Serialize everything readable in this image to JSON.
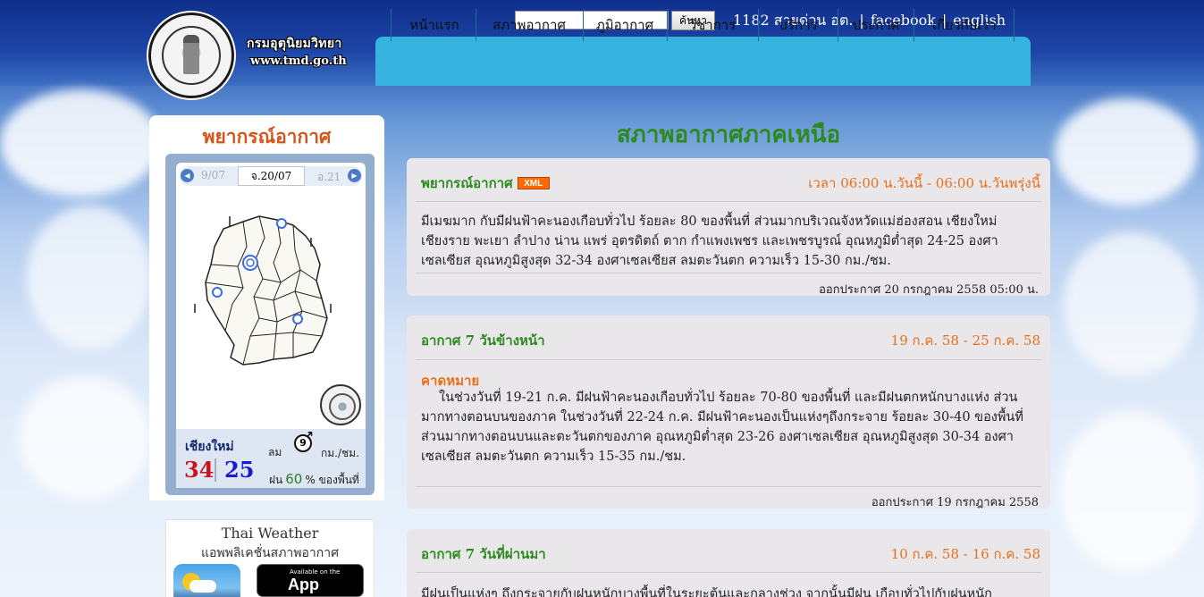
{
  "header": {
    "logo_text_th": "กรมอุตุนิยมวิทยา",
    "logo_url": "www.tmd.go.th",
    "search": {
      "value": "",
      "button_label": "ค้นหา"
    },
    "hotline": "1182 สายด่วน อต.",
    "facebook_label": "facebook",
    "english_label": "english"
  },
  "nav": {
    "items": [
      {
        "label": "หน้าแรก"
      },
      {
        "label": "สภาพอากาศ"
      },
      {
        "label": "ภูมิอากาศ"
      },
      {
        "label": "วิชาการ"
      },
      {
        "label": "บริการ"
      },
      {
        "label": "ประกาศ"
      },
      {
        "label": "เกี่ยวกับเรา"
      }
    ]
  },
  "sidebar": {
    "title": "พยากรณ์อากาศ",
    "dates": {
      "prev": "9/07",
      "current": "จ.20/07",
      "next": "อ.21"
    },
    "station": {
      "name": "เชียงใหม่",
      "temp_max": "34",
      "temp_min": "25",
      "wind_label": "ลม",
      "wind_speed": "9",
      "wind_unit": "กม./ชม.",
      "rain_label": "ฝน",
      "rain_value": "60",
      "rain_unit": "% ของพื้นที่"
    },
    "app": {
      "title": "Thai Weather",
      "subtitle": "แอพพลิเคชั่นสภาพอากาศ",
      "store_small": "Available on the",
      "store_big": "App Store"
    }
  },
  "main": {
    "title": "สภาพอากาศภาคเหนือ",
    "forecast": {
      "title": "พยากรณ์อากาศ",
      "xml_label": "XML",
      "period": "เวลา 06:00 น.วันนี้ - 06:00 น.วันพรุ่งนี้",
      "text": "มีเมฆมาก กับมีฝนฟ้าคะนองเกือบทั่วไป ร้อยละ 80 ของพื้นที่ ส่วนมากบริเวณจังหวัดแม่ฮ่องสอน เชียงใหม่ เชียงราย พะเยา ลำปาง น่าน แพร่ อุตรดิตถ์ ตาก กำแพงเพชร และเพชรบูรณ์ อุณหภูมิต่ำสุด 24-25 องศาเซลเซียส อุณหภูมิสูงสุด 32-34 องศาเซลเซียส ลมตะวันตก ความเร็ว 15-30 กม./ชม.",
      "issued": "ออกประกาศ 20 กรกฎาคม 2558 05:00 น."
    },
    "seven_day": {
      "title": "อากาศ 7 วันข้างหน้า",
      "period": "19 ก.ค. 58 - 25 ก.ค. 58",
      "subheading": "คาดหมาย",
      "text": "ในช่วงวันที่ 19-21 ก.ค. มีฝนฟ้าคะนองเกือบทั่วไป ร้อยละ 70-80 ของพื้นที่ และมีฝนตกหนักบางแห่ง ส่วนมากทางตอนบนของภาค ในช่วงวันที่ 22-24 ก.ค. มีฝนฟ้าคะนองเป็นแห่งๆถึงกระจาย ร้อยละ 30-40 ของพื้นที่ ส่วนมากทางตอนบนและตะวันตกของภาค อุณหภูมิต่ำสุด 23-26 องศาเซลเซียส อุณหภูมิสูงสุด 30-34 องศาเซลเซียส ลมตะวันตก ความเร็ว 15-35 กม./ชม.",
      "issued": "ออกประกาศ 19 กรกฎาคม 2558"
    },
    "past_seven": {
      "title": "อากาศ 7 วันที่ผ่านมา",
      "period": "10 ก.ค. 58 - 16 ก.ค. 58",
      "text": "มีฝนเป็นแห่งๆ ถึงกระจายกับฝนหนักบางพื้นที่ในระยะต้นและกลางช่วง จากนั้นมีฝน เกือบทั่วไปกับฝนหนัก"
    }
  }
}
